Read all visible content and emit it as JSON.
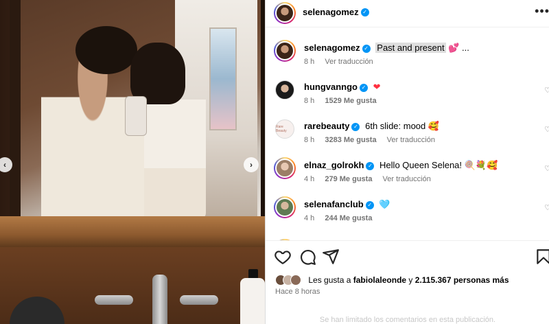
{
  "post": {
    "image_alt": "Mirror selfie photo",
    "nav_prev": "‹",
    "nav_next": "›"
  },
  "header": {
    "username": "selenagomez",
    "more": "•••"
  },
  "comments": [
    {
      "username": "selenagomez",
      "text": "Past and present",
      "emoji": "💕",
      "ellipsis": "...",
      "time": "8 h",
      "likes": "",
      "translate": "Ver traducción",
      "avatar_color": "#7a4a35"
    },
    {
      "username": "hungvanngo",
      "text": "",
      "emoji": "❤",
      "time": "8 h",
      "likes": "1529 Me gusta",
      "translate": "",
      "avatar_color": "#2b2b2b"
    },
    {
      "username": "rarebeauty",
      "text": "6th slide: mood",
      "emoji": "🥰",
      "time": "8 h",
      "likes": "3283 Me gusta",
      "translate": "Ver traducción",
      "avatar_color": "#f4ecea",
      "avatar_label": "Rare Beauty"
    },
    {
      "username": "elnaz_golrokh",
      "text": "Hello Queen Selena!",
      "emoji": "🍭💐🥰",
      "time": "4 h",
      "likes": "279 Me gusta",
      "translate": "Ver traducción",
      "avatar_color": "#b8a08a"
    },
    {
      "username": "selenafanclub",
      "text": "",
      "emoji": "🩵",
      "time": "4 h",
      "likes": "244 Me gusta",
      "translate": "",
      "avatar_color": "#6b8a5e"
    }
  ],
  "actions": {
    "likes_prefix": "Les gusta a",
    "likes_user": "fabiolaleonde",
    "likes_and": "y",
    "likes_count": "2.115.367 personas más",
    "time_ago": "Hace 8 horas",
    "limited": "Se han limitado los comentarios en esta publicación."
  },
  "colors": {
    "verified": "#0095f6",
    "heart": "#ff3040",
    "secondary_text": "#737373"
  }
}
